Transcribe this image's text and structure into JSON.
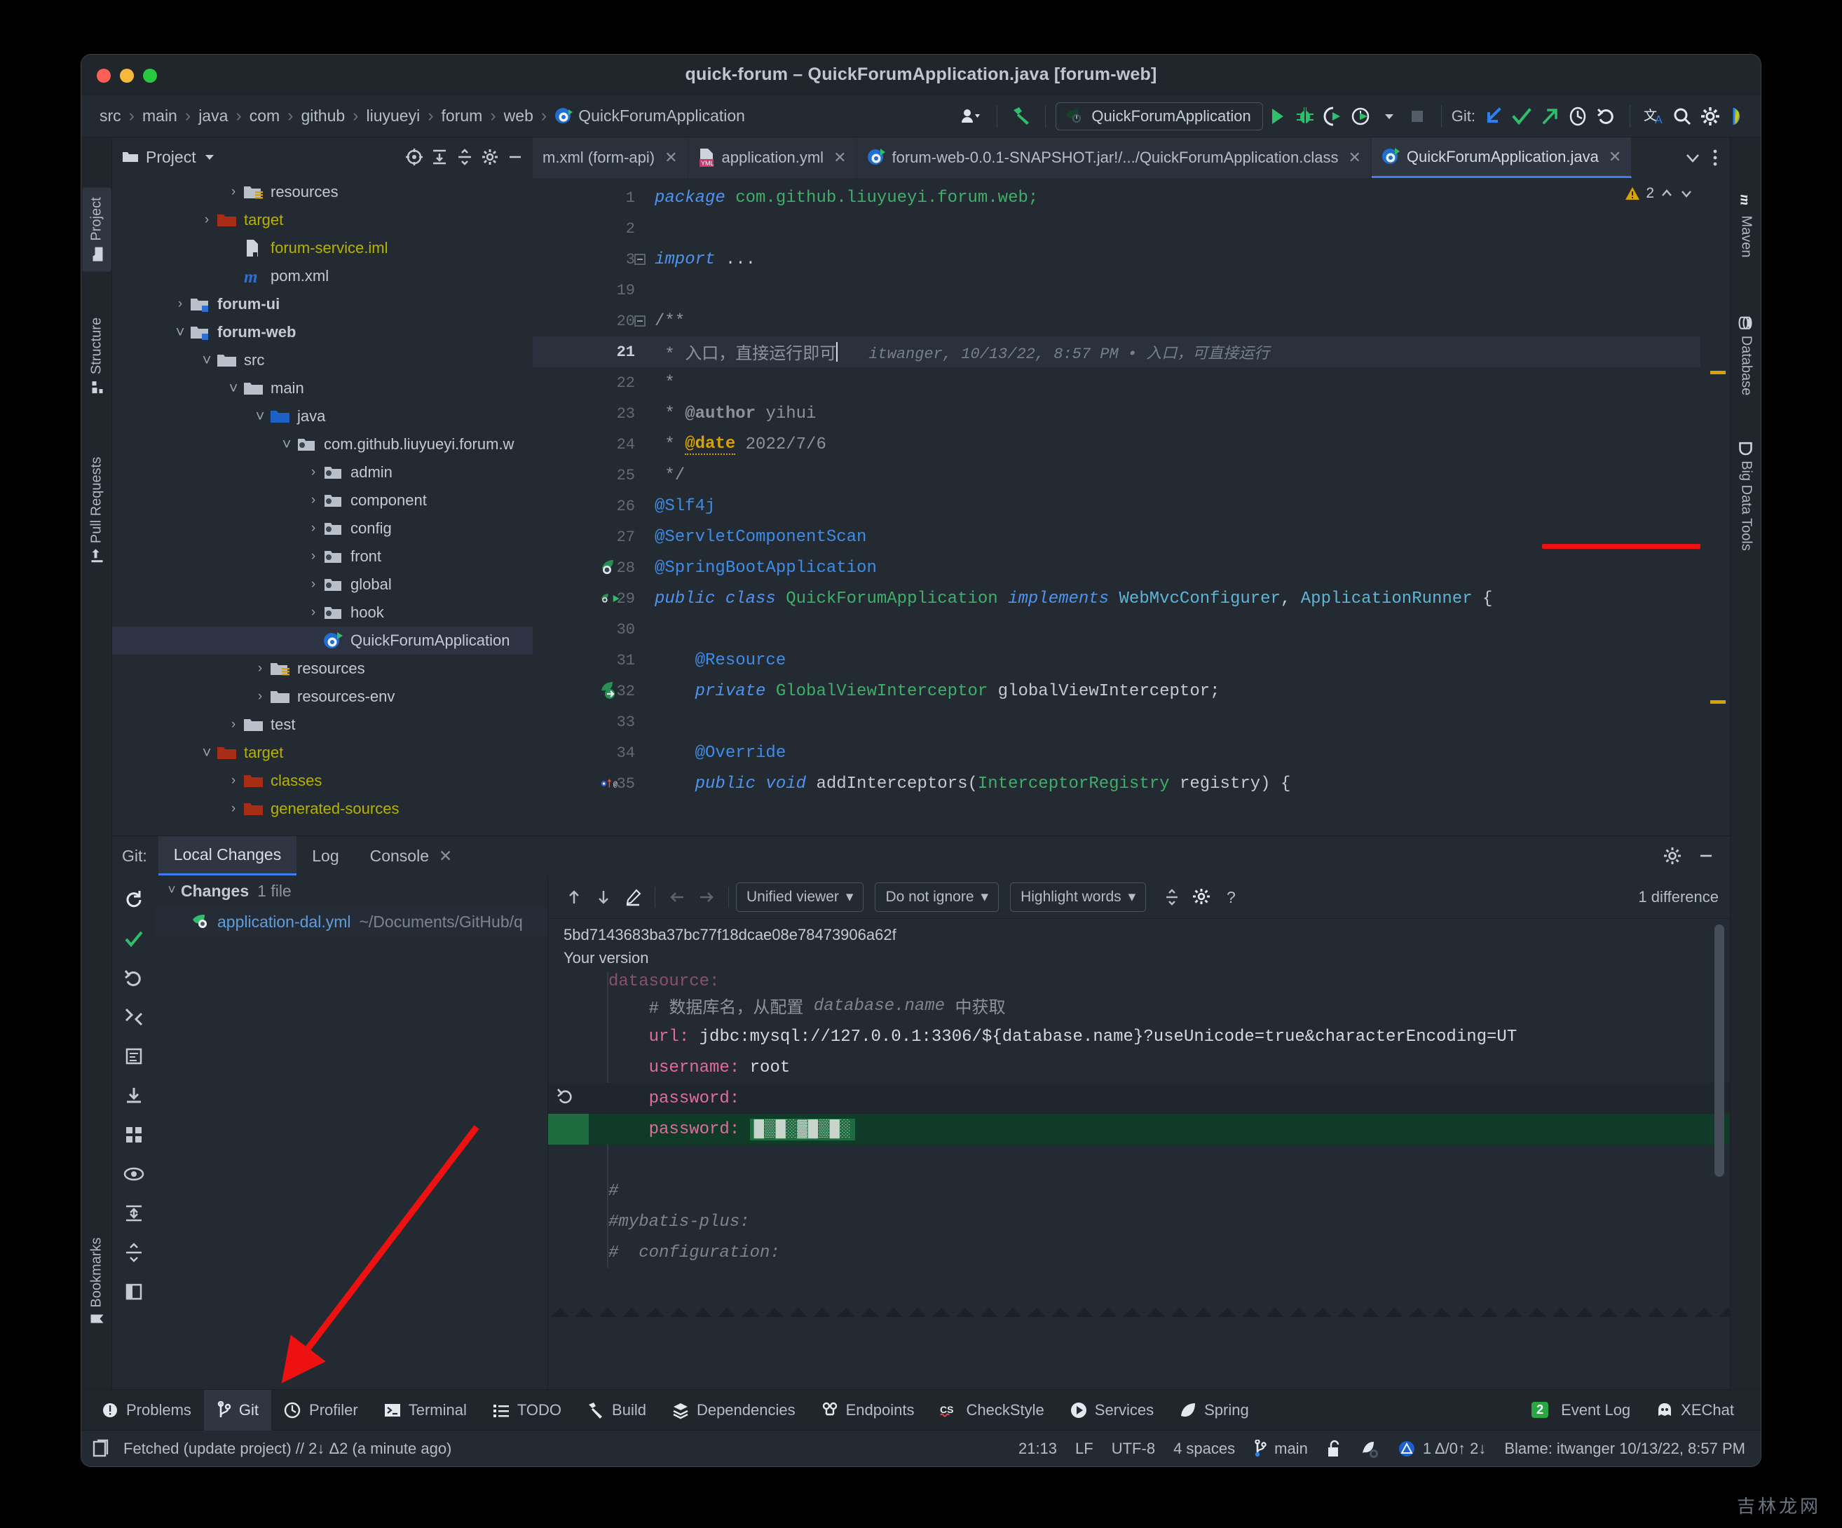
{
  "window": {
    "title": "quick-forum – QuickForumApplication.java [forum-web]"
  },
  "navbar": {
    "breadcrumbs": [
      "src",
      "main",
      "java",
      "com",
      "github",
      "liuyueyi",
      "forum",
      "web",
      "QuickForumApplication"
    ],
    "separator": "›",
    "run_config": "QuickForumApplication",
    "git_label": "Git:",
    "icons": [
      {
        "name": "user-avatar-icon",
        "glyph": "👥"
      },
      {
        "name": "build-hammer-icon",
        "glyph": "⚒"
      },
      {
        "name": "run-icon",
        "glyph": "▶"
      },
      {
        "name": "debug-icon",
        "glyph": "🐞"
      },
      {
        "name": "run-with-coverage-icon",
        "glyph": "↻"
      },
      {
        "name": "profile-icon",
        "glyph": "◔"
      },
      {
        "name": "stop-icon",
        "glyph": "■"
      },
      {
        "name": "git-update-icon",
        "glyph": "↙"
      },
      {
        "name": "git-commit-icon",
        "glyph": "✓"
      },
      {
        "name": "git-push-icon",
        "glyph": "↗"
      },
      {
        "name": "git-history-icon",
        "glyph": "◷"
      },
      {
        "name": "git-rollback-icon",
        "glyph": "↶"
      },
      {
        "name": "translate-icon",
        "glyph": "文A"
      },
      {
        "name": "search-everywhere-icon",
        "glyph": "🔍"
      },
      {
        "name": "settings-gear-icon",
        "glyph": "⚙"
      },
      {
        "name": "ide-feature-icon",
        "glyph": "◕"
      }
    ]
  },
  "left_strip": {
    "items": [
      {
        "label": "Project",
        "icon": "project-folder-icon",
        "active": true
      },
      {
        "label": "Structure",
        "icon": "structure-icon",
        "active": false
      },
      {
        "label": "Pull Requests",
        "icon": "pull-requests-icon",
        "active": false
      },
      {
        "label": "Bookmarks",
        "icon": "bookmarks-icon",
        "active": false
      }
    ]
  },
  "right_strip": {
    "items": [
      {
        "label": "Maven",
        "icon": "maven-m-icon"
      },
      {
        "label": "Database",
        "icon": "database-icon"
      },
      {
        "label": "Big Data Tools",
        "icon": "big-data-tools-icon"
      }
    ]
  },
  "project_panel": {
    "title": "Project",
    "header_icons": [
      {
        "name": "select-opened-file-icon",
        "glyph": "◎"
      },
      {
        "name": "expand-all-icon",
        "glyph": "⤓"
      },
      {
        "name": "collapse-all-icon",
        "glyph": "⤑"
      },
      {
        "name": "settings-gear-icon",
        "glyph": "⚙"
      },
      {
        "name": "hide-panel-icon",
        "glyph": "—"
      }
    ],
    "tree": [
      {
        "label": "resources",
        "indent": 4,
        "chevron": "right",
        "icon": "folder-resources",
        "style": "plain"
      },
      {
        "label": "target",
        "indent": 3,
        "chevron": "right",
        "icon": "folder-red",
        "style": "yellow"
      },
      {
        "label": "forum-service.iml",
        "indent": 4,
        "chevron": "none",
        "icon": "iml-file",
        "style": "yellow"
      },
      {
        "label": "pom.xml",
        "indent": 4,
        "chevron": "none",
        "icon": "maven-m",
        "style": "plain"
      },
      {
        "label": "forum-ui",
        "indent": 2,
        "chevron": "right",
        "icon": "folder-module",
        "style": "bold"
      },
      {
        "label": "forum-web",
        "indent": 2,
        "chevron": "down",
        "icon": "folder-module",
        "style": "bold"
      },
      {
        "label": "src",
        "indent": 3,
        "chevron": "down",
        "icon": "folder-gray",
        "style": "plain"
      },
      {
        "label": "main",
        "indent": 4,
        "chevron": "down",
        "icon": "folder-gray",
        "style": "plain"
      },
      {
        "label": "java",
        "indent": 5,
        "chevron": "down",
        "icon": "folder-blue",
        "style": "plain"
      },
      {
        "label": "com.github.liuyueyi.forum.w",
        "indent": 6,
        "chevron": "down",
        "icon": "package",
        "style": "plain"
      },
      {
        "label": "admin",
        "indent": 7,
        "chevron": "right",
        "icon": "package",
        "style": "plain"
      },
      {
        "label": "component",
        "indent": 7,
        "chevron": "right",
        "icon": "package",
        "style": "plain"
      },
      {
        "label": "config",
        "indent": 7,
        "chevron": "right",
        "icon": "package",
        "style": "plain"
      },
      {
        "label": "front",
        "indent": 7,
        "chevron": "right",
        "icon": "package",
        "style": "plain"
      },
      {
        "label": "global",
        "indent": 7,
        "chevron": "right",
        "icon": "package",
        "style": "plain"
      },
      {
        "label": "hook",
        "indent": 7,
        "chevron": "right",
        "icon": "package",
        "style": "plain"
      },
      {
        "label": "QuickForumApplication",
        "indent": 7,
        "chevron": "none",
        "icon": "spring-run",
        "style": "plain",
        "selected": true
      },
      {
        "label": "resources",
        "indent": 5,
        "chevron": "right",
        "icon": "folder-resources",
        "style": "plain"
      },
      {
        "label": "resources-env",
        "indent": 5,
        "chevron": "right",
        "icon": "folder-gray",
        "style": "plain"
      },
      {
        "label": "test",
        "indent": 4,
        "chevron": "right",
        "icon": "folder-gray",
        "style": "plain"
      },
      {
        "label": "target",
        "indent": 3,
        "chevron": "down",
        "icon": "folder-red",
        "style": "yellow"
      },
      {
        "label": "classes",
        "indent": 4,
        "chevron": "right",
        "icon": "folder-red",
        "style": "yellow"
      },
      {
        "label": "generated-sources",
        "indent": 4,
        "chevron": "right",
        "icon": "folder-red",
        "style": "yellow"
      }
    ]
  },
  "editor": {
    "tabs": [
      {
        "label": "m.xml (form-api)",
        "icon": "xml-file-icon",
        "active": false,
        "closable": true
      },
      {
        "label": "application.yml",
        "icon": "yml-file-icon",
        "active": false,
        "closable": true
      },
      {
        "label": "forum-web-0.0.1-SNAPSHOT.jar!/.../QuickForumApplication.class",
        "icon": "spring-class-icon",
        "active": false,
        "closable": true
      },
      {
        "label": "QuickForumApplication.java",
        "icon": "spring-class-icon",
        "active": true,
        "closable": true
      }
    ],
    "tab_overflow_icon": "chevron-down-icon",
    "tab_options_icon": "more-options-icon",
    "inspection_count": "2",
    "inspection_icon": "warning-triangle-icon",
    "lines": [
      {
        "num": "1",
        "tokens": [
          {
            "t": "package ",
            "c": "kw"
          },
          {
            "t": "com.github.liuyueyi.forum.web;",
            "c": "cls"
          }
        ]
      },
      {
        "num": "2",
        "tokens": []
      },
      {
        "num": "3",
        "tokens": [
          {
            "t": "import ",
            "c": "kw"
          },
          {
            "t": "...",
            "c": "plain"
          }
        ],
        "fold": true
      },
      {
        "num": "19",
        "tokens": []
      },
      {
        "num": "20",
        "tokens": [
          {
            "t": "/**",
            "c": "cmt"
          }
        ],
        "fold": true
      },
      {
        "num": "21",
        "tokens": [
          {
            "t": " * 入口，直接运行即可",
            "c": "cmt"
          }
        ],
        "current": true,
        "annotation": "itwanger, 10/13/22, 8:57 PM • 入口，可直接运行"
      },
      {
        "num": "22",
        "tokens": [
          {
            "t": " *",
            "c": "cmt"
          }
        ]
      },
      {
        "num": "23",
        "tokens": [
          {
            "t": " * ",
            "c": "cmt"
          },
          {
            "t": "@author",
            "c": "annoY2"
          },
          {
            "t": " yihui",
            "c": "cmt"
          }
        ]
      },
      {
        "num": "24",
        "tokens": [
          {
            "t": " * ",
            "c": "cmt"
          },
          {
            "t": "@date",
            "c": "annoY"
          },
          {
            "t": " 2022/7/6",
            "c": "cmt"
          }
        ]
      },
      {
        "num": "25",
        "tokens": [
          {
            "t": " */",
            "c": "cmt"
          }
        ]
      },
      {
        "num": "26",
        "tokens": [
          {
            "t": "@Slf4j",
            "c": "anno"
          }
        ]
      },
      {
        "num": "27",
        "tokens": [
          {
            "t": "@ServletComponentScan",
            "c": "anno"
          }
        ]
      },
      {
        "num": "28",
        "tokens": [
          {
            "t": "@SpringBootApplication",
            "c": "anno"
          }
        ],
        "gutter_icon": "spring-bean-icon"
      },
      {
        "num": "29",
        "tokens": [
          {
            "t": "public class ",
            "c": "kw"
          },
          {
            "t": "QuickForumApplication",
            "c": "cls"
          },
          {
            "t": " implements ",
            "c": "kw"
          },
          {
            "t": "WebMvcConfigurer",
            "c": "type"
          },
          {
            "t": ", ",
            "c": "plain"
          },
          {
            "t": "ApplicationRunner",
            "c": "type"
          },
          {
            "t": " {",
            "c": "plain"
          }
        ],
        "gutter_icon": "run-gutter-icon"
      },
      {
        "num": "30",
        "tokens": []
      },
      {
        "num": "31",
        "tokens": [
          {
            "t": "    @Resource",
            "c": "anno"
          }
        ]
      },
      {
        "num": "32",
        "tokens": [
          {
            "t": "    private ",
            "c": "kw"
          },
          {
            "t": "GlobalViewInterceptor",
            "c": "cls"
          },
          {
            "t": " globalViewInterceptor;",
            "c": "plain"
          }
        ],
        "gutter_icon": "bean-inject-icon"
      },
      {
        "num": "33",
        "tokens": []
      },
      {
        "num": "34",
        "tokens": [
          {
            "t": "    @Override",
            "c": "anno"
          }
        ]
      },
      {
        "num": "35",
        "tokens": [
          {
            "t": "    public void ",
            "c": "kw"
          },
          {
            "t": "addInterceptors",
            "c": "method"
          },
          {
            "t": "(",
            "c": "plain"
          },
          {
            "t": "InterceptorRegistry",
            "c": "cls"
          },
          {
            "t": " registry",
            "c": "plain"
          },
          {
            "t": ") {",
            "c": "plain"
          }
        ],
        "gutter_icon": "override-icon"
      }
    ]
  },
  "git_panel": {
    "label": "Git:",
    "tabs": [
      {
        "label": "Local Changes",
        "active": true,
        "closable": false
      },
      {
        "label": "Log",
        "active": false,
        "closable": false
      },
      {
        "label": "Console",
        "active": false,
        "closable": true
      }
    ],
    "header_icons": [
      {
        "name": "settings-gear-icon",
        "glyph": "⚙"
      },
      {
        "name": "hide-panel-icon",
        "glyph": "—"
      }
    ],
    "side_actions": [
      {
        "name": "refresh-icon",
        "glyph": "⟳"
      },
      {
        "name": "commit-checkmark-icon",
        "glyph": "✓"
      },
      {
        "name": "rollback-icon",
        "glyph": "↶"
      },
      {
        "name": "shelve-icon",
        "glyph": "⤨"
      },
      {
        "name": "show-diff-icon",
        "glyph": "▤"
      },
      {
        "name": "get-from-vcs-icon",
        "glyph": "⤓"
      },
      {
        "name": "group-by-icon",
        "glyph": "▦"
      },
      {
        "name": "preview-diff-icon",
        "glyph": "◉"
      },
      {
        "name": "expand-all-icon",
        "glyph": "⇲"
      },
      {
        "name": "collapse-all-icon",
        "glyph": "⇱"
      },
      {
        "name": "toggle-layout-icon",
        "glyph": "◧"
      }
    ],
    "changes": {
      "group_label": "Changes",
      "group_count": "1 file",
      "files": [
        {
          "name": "application-dal.yml",
          "path": "~/Documents/GitHub/q",
          "icon": "spring-yml-icon"
        }
      ]
    },
    "diff": {
      "toolbar": {
        "prev_icon": "arrow-up-icon",
        "next_icon": "arrow-down-icon",
        "edit_icon": "edit-pencil-icon",
        "left_icon": "arrow-left-icon",
        "right_icon": "arrow-right-icon",
        "viewer_mode": "Unified viewer",
        "ignore_mode": "Do not ignore",
        "highlight_mode": "Highlight words",
        "collapse_icon": "collapse-unchanged-icon",
        "settings_icon": "settings-gear-icon",
        "help_icon": "help-question-icon",
        "difference_count": "1 difference"
      },
      "revision_hash": "5bd7143683ba37bc77f18dcae08e78473906a62f",
      "your_version_label": "Your version",
      "lines": [
        {
          "type": "context-cut",
          "tokens": [
            {
              "t": "datasource:",
              "c": "key"
            }
          ]
        },
        {
          "type": "context",
          "tokens": [
            {
              "t": "    # 数据库名，从配置 ",
              "c": "dcmt2"
            },
            {
              "t": "database.name",
              "c": "dcmt"
            },
            {
              "t": " 中获取",
              "c": "dcmt2"
            }
          ]
        },
        {
          "type": "context",
          "tokens": [
            {
              "t": "    url",
              "c": "key"
            },
            {
              "t": ": ",
              "c": "key"
            },
            {
              "t": "jdbc:mysql://127.0.0.1:3306/${database.name}?useUnicode=true&characterEncoding=UT",
              "c": "val"
            }
          ]
        },
        {
          "type": "context",
          "tokens": [
            {
              "t": "    username",
              "c": "key"
            },
            {
              "t": ": ",
              "c": "key"
            },
            {
              "t": "root",
              "c": "val"
            }
          ]
        },
        {
          "type": "removed-marker",
          "tokens": [
            {
              "t": "    password",
              "c": "key"
            },
            {
              "t": ":",
              "c": "key"
            }
          ]
        },
        {
          "type": "added",
          "tokens": [
            {
              "t": "    password",
              "c": "key"
            },
            {
              "t": ": ",
              "c": "key"
            }
          ],
          "masked_value": "█▒█░▓█▒█░"
        },
        {
          "type": "blank",
          "tokens": []
        },
        {
          "type": "context",
          "tokens": [
            {
              "t": "#",
              "c": "dcmt"
            }
          ]
        },
        {
          "type": "context",
          "tokens": [
            {
              "t": "#mybatis-plus:",
              "c": "dcmt"
            }
          ]
        },
        {
          "type": "context",
          "tokens": [
            {
              "t": "#  configuration:",
              "c": "dcmt"
            }
          ]
        }
      ]
    }
  },
  "tool_windows": {
    "left": [
      {
        "label": "Problems",
        "icon": "problems-icon",
        "active": false
      },
      {
        "label": "Git",
        "icon": "git-branch-icon",
        "active": true
      },
      {
        "label": "Profiler",
        "icon": "profiler-icon",
        "active": false
      },
      {
        "label": "Terminal",
        "icon": "terminal-icon",
        "active": false
      },
      {
        "label": "TODO",
        "icon": "todo-list-icon",
        "active": false
      },
      {
        "label": "Build",
        "icon": "build-hammer-icon",
        "active": false
      },
      {
        "label": "Dependencies",
        "icon": "dependencies-icon",
        "active": false
      },
      {
        "label": "Endpoints",
        "icon": "endpoints-icon",
        "active": false
      },
      {
        "label": "CheckStyle",
        "icon": "checkstyle-icon",
        "active": false
      },
      {
        "label": "Services",
        "icon": "services-icon",
        "active": false
      },
      {
        "label": "Spring",
        "icon": "spring-leaf-icon",
        "active": false
      }
    ],
    "right": [
      {
        "label": "Event Log",
        "icon": "event-log-icon",
        "badge": "2"
      },
      {
        "label": "XEChat",
        "icon": "xechat-icon",
        "badge": ""
      }
    ]
  },
  "status_bar": {
    "left_icon": "project-files-icon",
    "message": "Fetched (update project) // 2↓ Δ2 (a minute ago)",
    "right": [
      {
        "name": "cursor-position",
        "text": "21:13"
      },
      {
        "name": "line-separator",
        "text": "LF"
      },
      {
        "name": "file-encoding",
        "text": "UTF-8"
      },
      {
        "name": "indent-size",
        "text": "4 spaces"
      },
      {
        "name": "git-branch",
        "text": "main",
        "icon": "git-branch-icon"
      },
      {
        "name": "read-only-toggle",
        "text": "",
        "icon": "lock-open-icon"
      },
      {
        "name": "inspections-toggle",
        "text": "",
        "icon": "inspector-icon"
      },
      {
        "name": "vcs-changes",
        "text": "1 Δ/0↑ 2↓",
        "icon": "vcs-triangle-icon"
      },
      {
        "name": "blame-info",
        "text": "Blame: itwanger 10/13/22, 8:57 PM"
      }
    ]
  },
  "annotations": {
    "red_arrow": "points-to-git-tool-window",
    "red_underline": "highlights-inline-blame-annotation"
  },
  "watermark": "吉林龙网",
  "colors": {
    "accent_blue": "#3d7ff0",
    "window_bg": "#242a31",
    "panel_bg": "#21262d",
    "selection": "#2d3343",
    "added_green": "#0f3b28",
    "annotation_red": "#ee1111",
    "keyword_blue": "#4e93ef",
    "string_green": "#49a36b",
    "yellow_folder": "#b5b300"
  }
}
